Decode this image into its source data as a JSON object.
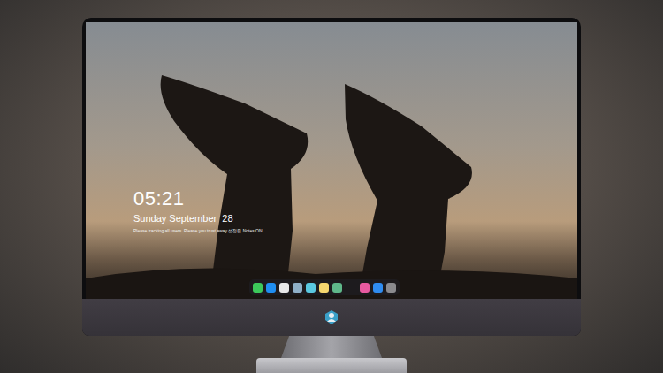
{
  "lock_screen": {
    "time": "05:21",
    "date": "Sunday September  28",
    "notice": "Please tracking all users. Please you trust away 설정됨 Notes ON"
  },
  "dock": {
    "items": [
      {
        "kind": "app",
        "color": "#3cc85a"
      },
      {
        "kind": "app",
        "color": "#1f8ef0"
      },
      {
        "kind": "app",
        "color": "#e8e8e8"
      },
      {
        "kind": "app",
        "color": "#8fb0c8"
      },
      {
        "kind": "app",
        "color": "#5ac8e0"
      },
      {
        "kind": "app",
        "color": "#f5d76e"
      },
      {
        "kind": "app",
        "color": "#5fb88a"
      },
      {
        "kind": "gap",
        "color": "#000000"
      },
      {
        "kind": "app",
        "color": "#e85aa0"
      },
      {
        "kind": "app",
        "color": "#2f8cf0"
      },
      {
        "kind": "app",
        "color": "#8a8a8e"
      }
    ]
  }
}
